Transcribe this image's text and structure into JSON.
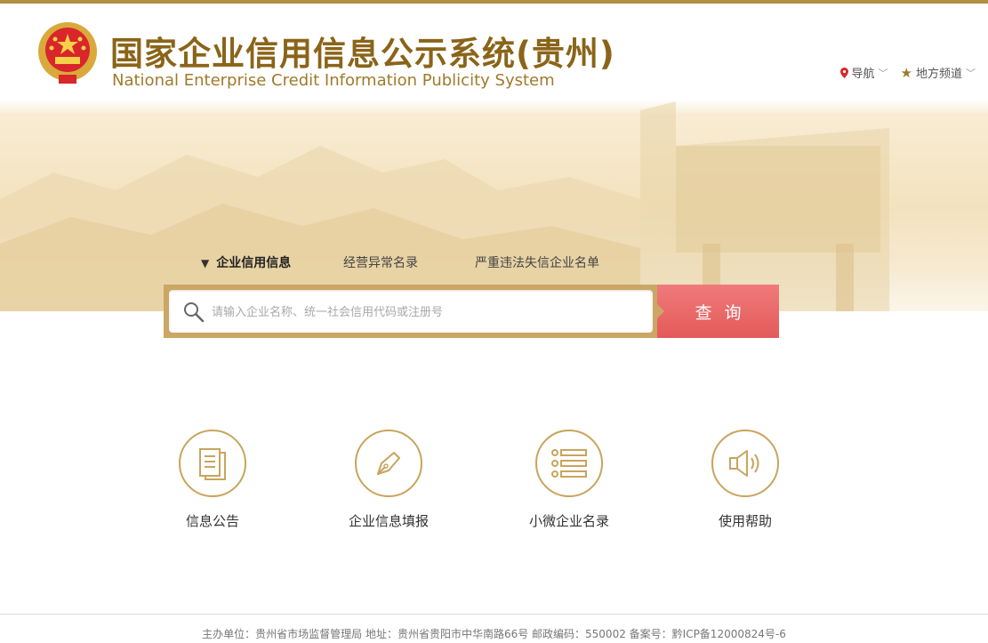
{
  "header": {
    "title_cn": "国家企业信用信息公示系统(贵州)",
    "title_en": "National Enterprise Credit Information Publicity System",
    "nav_label": "导航",
    "local_channel_label": "地方频道"
  },
  "tabs": [
    {
      "label": "企业信用信息",
      "active": true
    },
    {
      "label": "经营异常名录",
      "active": false
    },
    {
      "label": "严重违法失信企业名单",
      "active": false
    }
  ],
  "search": {
    "placeholder": "请输入企业名称、统一社会信用代码或注册号",
    "value": "",
    "button_label": "查询"
  },
  "services": [
    {
      "label": "信息公告",
      "icon": "document-icon"
    },
    {
      "label": "企业信息填报",
      "icon": "pen-icon"
    },
    {
      "label": "小微企业名录",
      "icon": "list-icon"
    },
    {
      "label": "使用帮助",
      "icon": "speaker-icon"
    }
  ],
  "footer": {
    "text": "主办单位：贵州省市场监督管理局 地址：贵州省贵阳市中华南路66号 邮政编码：550002 备案号：黔ICP备12000824号-6"
  },
  "colors": {
    "accent_gold": "#b58f3f",
    "search_button": "#e45a5a",
    "title_brown": "#8a6418"
  }
}
